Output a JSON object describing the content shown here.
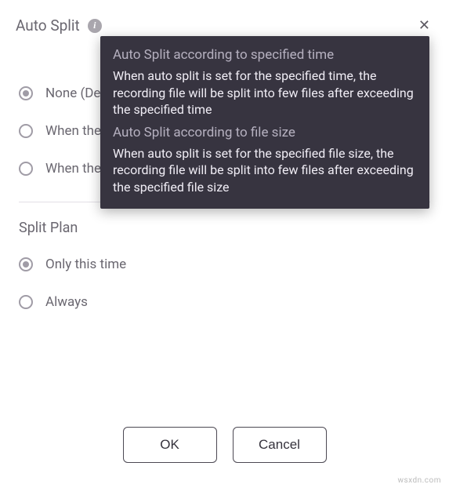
{
  "header": {
    "title": "Auto Split"
  },
  "autosplit": {
    "options": [
      {
        "label": "None (Default)",
        "selected": true
      },
      {
        "label": "When the",
        "selected": false
      },
      {
        "label": "When the",
        "selected": false
      }
    ]
  },
  "tooltip": {
    "heading1": "Auto Split according to specified time",
    "body1": "When auto split is set for the specified time, the recording file will be split into few files after exceeding the specified time",
    "heading2": "Auto Split according to file size",
    "body2": "When auto split is set for the specified file size, the recording file will be split into few files after exceeding the specified file size"
  },
  "splitplan": {
    "title": "Split Plan",
    "options": [
      {
        "label": "Only this time",
        "selected": true
      },
      {
        "label": "Always",
        "selected": false
      }
    ]
  },
  "buttons": {
    "ok": "OK",
    "cancel": "Cancel"
  },
  "watermark": "wsxdn.com"
}
